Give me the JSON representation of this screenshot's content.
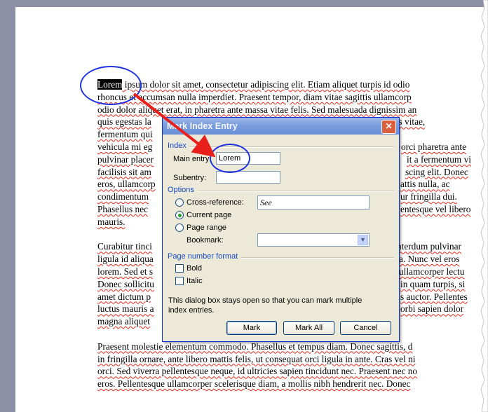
{
  "document": {
    "paragraphs": [
      {
        "lines": [
          {
            "first": "Lorem",
            "rest": " ipsum dolor sit amet, consectetur adipiscing elit. Etiam aliquet turpis id odio"
          },
          {
            "text": "rhoncus et accumsan nulla imperdiet. Praesent tempor, diam vitae sagittis ullamcorp"
          },
          {
            "text": "odio dolor aliquet erat, in pharetra ante massa vitae felis. Sed malesuada dignissim an"
          },
          {
            "text": "quis egestas la",
            "tail": "apibus vitae,"
          },
          {
            "text": "fermentum qui",
            "tail": ""
          },
          {
            "text": "vehicula mi eg",
            "tail": "orci pharetra ante"
          },
          {
            "text": "pulvinar placer",
            "tail": "it a fermentum vi"
          },
          {
            "text": "facilisis sit am",
            "tail": "scing elit. Donec"
          },
          {
            "text": "eros, ullamcorp",
            "tail": "attis nulla, ac"
          },
          {
            "text": "condimentum",
            "tail": "ur fringilla dui."
          },
          {
            "text": "Phasellus nec",
            "tail": "entesque vel libero"
          },
          {
            "text": "mauris.",
            "tail": ""
          }
        ]
      },
      {
        "lines": [
          {
            "text": "Curabitur tinci",
            "tail": "nterdum pulvinar"
          },
          {
            "text": "ligula id aliqua",
            "tail": "a. Nunc vel eros"
          },
          {
            "text": "lorem. Sed et s",
            "tail": "ullamcorper lectu"
          },
          {
            "text": "Donec sollicitu",
            "tail": "in quam turpis, si"
          },
          {
            "text": "amet dictum p",
            "tail": "s auctor. Pellentes"
          },
          {
            "text": "luctus mauris a",
            "tail": "orbi sapien dolor"
          },
          {
            "text": "magna aliquet",
            "tail": ""
          }
        ]
      },
      {
        "lines": [
          {
            "text": "Praesent molestie elementum commodo. Phasellus et tempus diam. Donec sagittis, d"
          },
          {
            "text": "in fringilla ornare, ante libero mattis felis, ut consequat orci ligula in ante. Cras vel ni"
          },
          {
            "text": "orci. Sed viverra pellentesque neque, id ultricies sapien tincidunt nec. Praesent nec no"
          },
          {
            "text": "eros. Pellentesque ullamcorper scelerisque diam, a mollis nibh hendrerit nec. Donec"
          }
        ]
      }
    ]
  },
  "dialog": {
    "title": "Mark Index Entry",
    "close_glyph": "✕",
    "index_section": "Index",
    "main_entry_label": "Main entry:",
    "main_entry_value": "Lorem",
    "subentry_label": "Subentry:",
    "subentry_value": "",
    "options_section": "Options",
    "cross_reference_label": "Cross-reference:",
    "cross_reference_value": "See",
    "current_page_label": "Current page",
    "page_range_label": "Page range",
    "bookmark_label": "Bookmark:",
    "bookmark_value": "",
    "selected_option": "current_page",
    "page_number_format_section": "Page number format",
    "bold_label": "Bold",
    "italic_label": "Italic",
    "note_line1": "This dialog box stays open so that you can mark multiple",
    "note_line2": "index entries.",
    "mark_button": "Mark",
    "mark_all_button": "Mark All",
    "cancel_button": "Cancel",
    "dropdown_glyph": "▼"
  },
  "colors": {
    "annotation_ring": "#2233e0",
    "annotation_arrow": "#e8201b",
    "section_header": "#1649c4",
    "title_bar": "#7a9ddd"
  }
}
